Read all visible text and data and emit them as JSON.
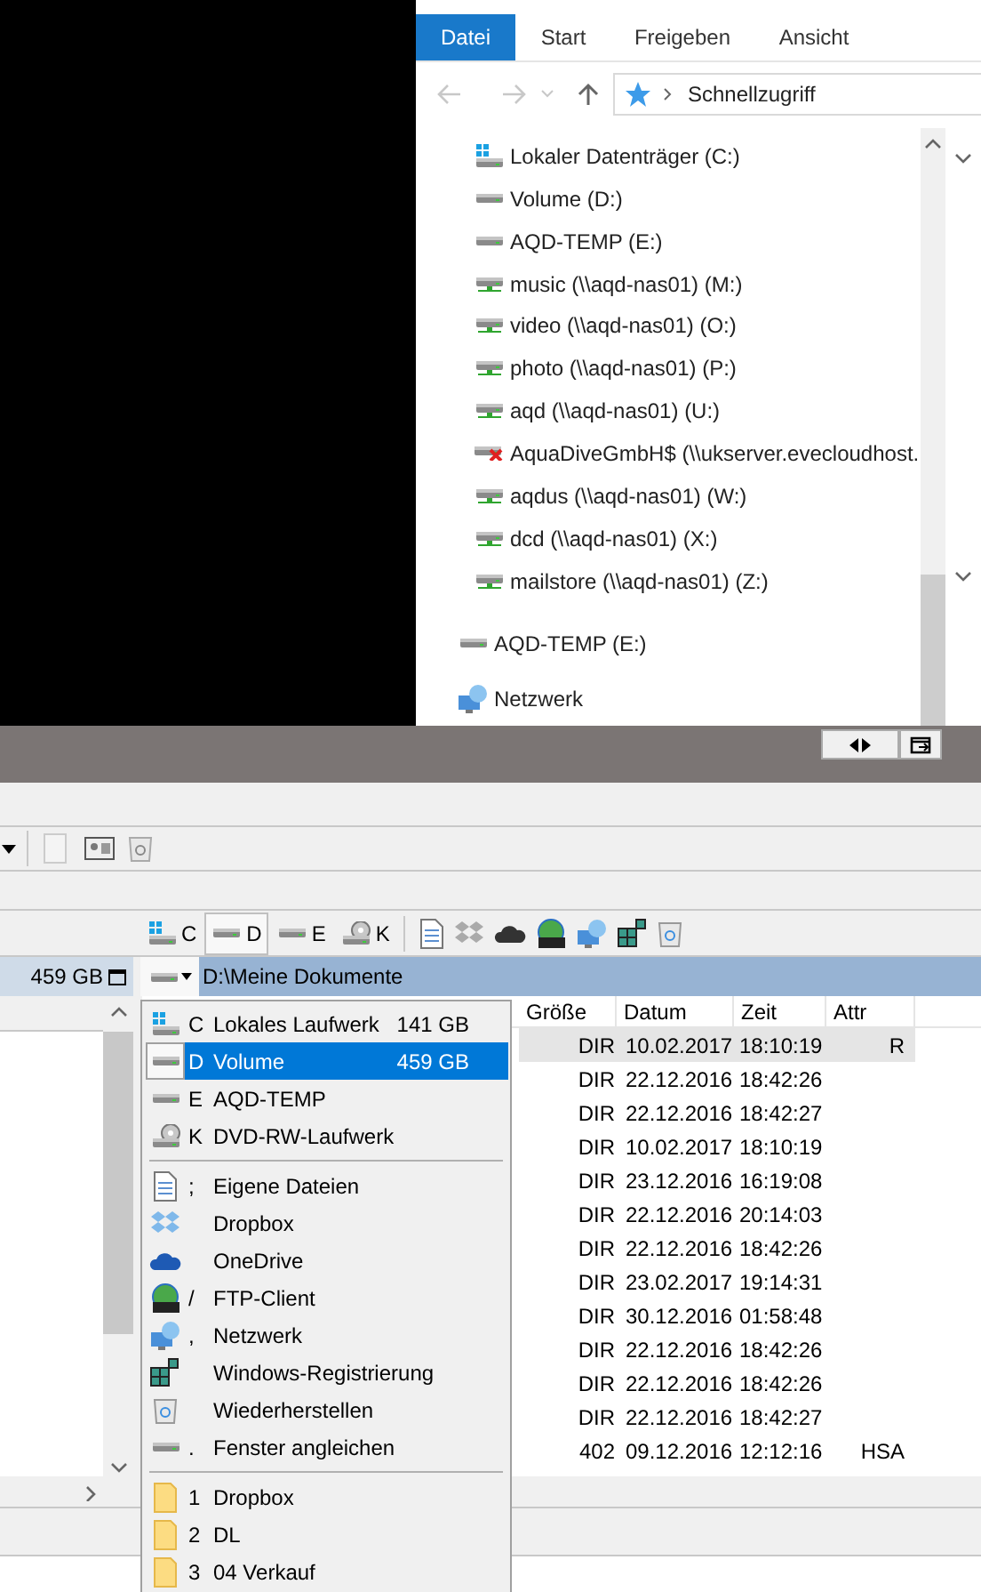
{
  "explorer": {
    "ribbon_tabs": [
      {
        "label": "Datei",
        "selected": true
      },
      {
        "label": "Start",
        "selected": false
      },
      {
        "label": "Freigeben",
        "selected": false
      },
      {
        "label": "Ansicht",
        "selected": false
      }
    ],
    "address": {
      "path": "Schnellzugriff"
    },
    "drives": [
      {
        "label": "Lokaler Datenträger (C:)",
        "kind": "system"
      },
      {
        "label": "Volume (D:)",
        "kind": "local"
      },
      {
        "label": "AQD-TEMP (E:)",
        "kind": "local"
      },
      {
        "label": "music (\\\\aqd-nas01) (M:)",
        "kind": "network"
      },
      {
        "label": "video (\\\\aqd-nas01) (O:)",
        "kind": "network"
      },
      {
        "label": "photo (\\\\aqd-nas01) (P:)",
        "kind": "network"
      },
      {
        "label": "aqd (\\\\aqd-nas01) (U:)",
        "kind": "network"
      },
      {
        "label": "AquaDiveGmbH$ (\\\\ukserver.evecloudhost.",
        "kind": "offline"
      },
      {
        "label": "aqdus (\\\\aqd-nas01) (W:)",
        "kind": "network"
      },
      {
        "label": "dcd (\\\\aqd-nas01) (X:)",
        "kind": "network"
      },
      {
        "label": "mailstore (\\\\aqd-nas01) (Z:)",
        "kind": "network"
      }
    ],
    "tree_items": [
      {
        "label": "AQD-TEMP (E:)",
        "kind": "local"
      },
      {
        "label": "Netzwerk",
        "kind": "netzwerk"
      }
    ]
  },
  "commander": {
    "drive_buttons": [
      {
        "letter": "C",
        "kind": "system",
        "selected": false
      },
      {
        "letter": "D",
        "kind": "local",
        "selected": true
      },
      {
        "letter": "E",
        "kind": "local",
        "selected": false
      },
      {
        "letter": "K",
        "kind": "optical",
        "selected": false
      }
    ],
    "left_panel": {
      "free_space": "459 GB"
    },
    "path": "D:\\Meine Dokumente",
    "columns": [
      "Größe",
      "Datum",
      "Zeit",
      "Attr"
    ],
    "rows": [
      {
        "size": "DIR",
        "date": "10.02.2017",
        "time": "18:10:19",
        "attr": "R",
        "selected": true
      },
      {
        "size": "DIR",
        "date": "22.12.2016",
        "time": "18:42:26",
        "selected": false
      },
      {
        "size": "DIR",
        "date": "22.12.2016",
        "time": "18:42:27",
        "selected": false
      },
      {
        "size": "DIR",
        "date": "10.02.2017",
        "time": "18:10:19",
        "selected": false
      },
      {
        "size": "DIR",
        "date": "23.12.2016",
        "time": "16:19:08",
        "selected": false
      },
      {
        "size": "DIR",
        "date": "22.12.2016",
        "time": "20:14:03",
        "selected": false
      },
      {
        "size": "DIR",
        "date": "22.12.2016",
        "time": "18:42:26",
        "selected": false
      },
      {
        "size": "DIR",
        "date": "23.02.2017",
        "time": "19:14:31",
        "selected": false
      },
      {
        "size": "DIR",
        "date": "30.12.2016",
        "time": "01:58:48",
        "selected": false
      },
      {
        "size": "DIR",
        "date": "22.12.2016",
        "time": "18:42:26",
        "selected": false
      },
      {
        "size": "DIR",
        "date": "22.12.2016",
        "time": "18:42:26",
        "selected": false
      },
      {
        "size": "DIR",
        "date": "22.12.2016",
        "time": "18:42:27",
        "selected": false
      },
      {
        "size": "402",
        "date": "09.12.2016",
        "time": "12:12:16",
        "attr": "HSA",
        "selected": false
      }
    ],
    "drive_menu": {
      "drives": [
        {
          "key": "C",
          "name": "Lokales Laufwerk",
          "size": "141 GB",
          "kind": "system",
          "selected": false
        },
        {
          "key": "D",
          "name": "Volume",
          "size": "459 GB",
          "kind": "local",
          "selected": true
        },
        {
          "key": "E",
          "name": "AQD-TEMP",
          "kind": "local",
          "selected": false
        },
        {
          "key": "K",
          "name": "DVD-RW-Laufwerk",
          "kind": "optical",
          "selected": false
        }
      ],
      "shortcuts": [
        {
          "key": ";",
          "label": "Eigene Dateien",
          "kind": "documents"
        },
        {
          "label": "Dropbox",
          "kind": "dropbox"
        },
        {
          "label": "OneDrive",
          "kind": "cloud"
        },
        {
          "key": "/",
          "label": "FTP-Client",
          "kind": "ftp"
        },
        {
          "key": ",",
          "label": "Netzwerk",
          "kind": "netzwerk"
        },
        {
          "label": "Windows-Registrierung",
          "kind": "registry"
        },
        {
          "label": "Wiederherstellen",
          "kind": "recycle"
        },
        {
          "key": ".",
          "label": "Fenster angleichen",
          "kind": "local"
        }
      ],
      "folders": [
        {
          "key": "1",
          "label": "Dropbox"
        },
        {
          "key": "2",
          "label": "DL"
        },
        {
          "key": "3",
          "label": "04 Verkauf"
        }
      ]
    }
  }
}
